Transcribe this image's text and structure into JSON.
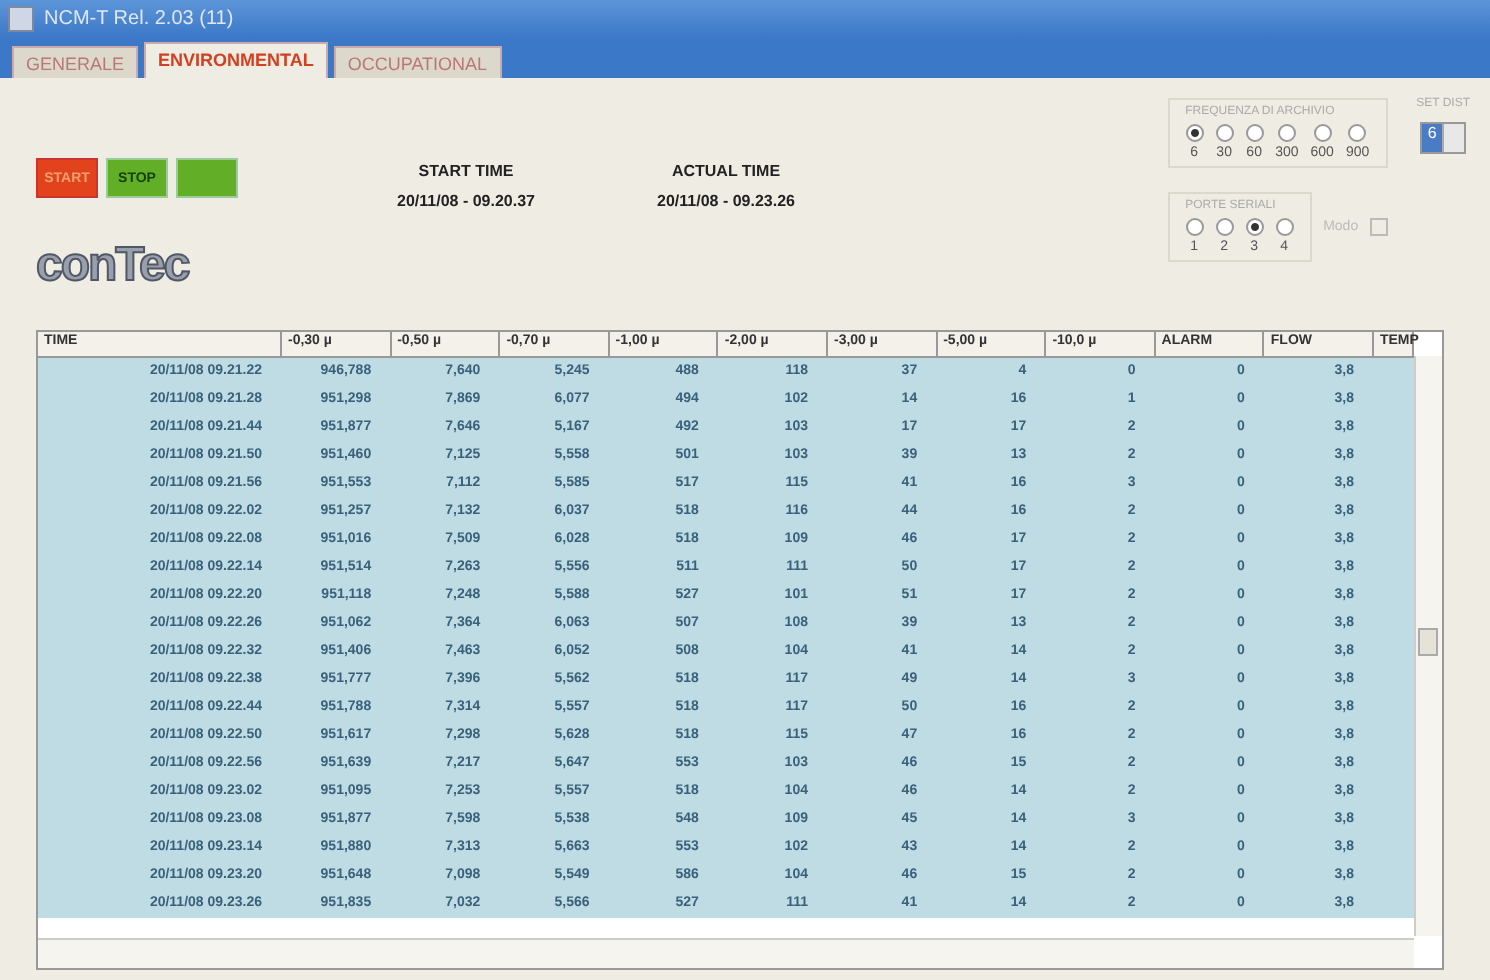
{
  "window": {
    "title": "NCM-T Rel. 2.03 (11)"
  },
  "tabs": [
    {
      "label": "GENERALE",
      "selected": false
    },
    {
      "label": "ENVIRONMENTAL",
      "selected": true
    },
    {
      "label": "OCCUPATIONAL",
      "selected": false
    }
  ],
  "buttons": [
    {
      "label": "START",
      "kind": "start"
    },
    {
      "label": "STOP",
      "kind": "stop"
    },
    {
      "kind": "plain"
    }
  ],
  "start_time": {
    "label": "START TIME",
    "value": "20/11/08 - 09.20.37"
  },
  "actual_time": {
    "label": "ACTUAL TIME",
    "value": "20/11/08 - 09.23.26"
  },
  "logo": {
    "text": "conTec"
  },
  "frequency": {
    "title": "FREQUENZA DI ARCHIVIO",
    "options": [
      {
        "label": "6",
        "selected": true
      },
      {
        "label": "30",
        "selected": false
      },
      {
        "label": "60",
        "selected": false
      },
      {
        "label": "300",
        "selected": false
      },
      {
        "label": "600",
        "selected": false
      },
      {
        "label": "900",
        "selected": false
      }
    ]
  },
  "serial_port": {
    "title": "PORTE SERIALI",
    "options": [
      {
        "label": "1",
        "selected": false
      },
      {
        "label": "2",
        "selected": false
      },
      {
        "label": "3",
        "selected": true
      },
      {
        "label": "4",
        "selected": false
      }
    ],
    "mode_label": "Modo",
    "mode_checked": false
  },
  "set_dist": {
    "label": "SET DIST",
    "value": "6"
  },
  "table": {
    "columns": [
      "TIME",
      "-0,30 µ",
      "-0,50 µ",
      "-0,70 µ",
      "-1,00 µ",
      "-2,00 µ",
      "-3,00 µ",
      "-5,00 µ",
      "-10,0 µ",
      "ALARM",
      "FLOW",
      "TEMP"
    ],
    "rows": [
      [
        "20/11/08 09.21.22",
        "946,788",
        "7,640",
        "5,245",
        "488",
        "118",
        "37",
        "4",
        "0",
        "0",
        "3,8"
      ],
      [
        "20/11/08 09.21.28",
        "951,298",
        "7,869",
        "6,077",
        "494",
        "102",
        "14",
        "16",
        "1",
        "0",
        "3,8"
      ],
      [
        "20/11/08 09.21.44",
        "951,877",
        "7,646",
        "5,167",
        "492",
        "103",
        "17",
        "17",
        "2",
        "0",
        "3,8"
      ],
      [
        "20/11/08 09.21.50",
        "951,460",
        "7,125",
        "5,558",
        "501",
        "103",
        "39",
        "13",
        "2",
        "0",
        "3,8"
      ],
      [
        "20/11/08 09.21.56",
        "951,553",
        "7,112",
        "5,585",
        "517",
        "115",
        "41",
        "16",
        "3",
        "0",
        "3,8"
      ],
      [
        "20/11/08 09.22.02",
        "951,257",
        "7,132",
        "6,037",
        "518",
        "116",
        "44",
        "16",
        "2",
        "0",
        "3,8"
      ],
      [
        "20/11/08 09.22.08",
        "951,016",
        "7,509",
        "6,028",
        "518",
        "109",
        "46",
        "17",
        "2",
        "0",
        "3,8"
      ],
      [
        "20/11/08 09.22.14",
        "951,514",
        "7,263",
        "5,556",
        "511",
        "111",
        "50",
        "17",
        "2",
        "0",
        "3,8"
      ],
      [
        "20/11/08 09.22.20",
        "951,118",
        "7,248",
        "5,588",
        "527",
        "101",
        "51",
        "17",
        "2",
        "0",
        "3,8"
      ],
      [
        "20/11/08 09.22.26",
        "951,062",
        "7,364",
        "6,063",
        "507",
        "108",
        "39",
        "13",
        "2",
        "0",
        "3,8"
      ],
      [
        "20/11/08 09.22.32",
        "951,406",
        "7,463",
        "6,052",
        "508",
        "104",
        "41",
        "14",
        "2",
        "0",
        "3,8"
      ],
      [
        "20/11/08 09.22.38",
        "951,777",
        "7,396",
        "5,562",
        "518",
        "117",
        "49",
        "14",
        "3",
        "0",
        "3,8"
      ],
      [
        "20/11/08 09.22.44",
        "951,788",
        "7,314",
        "5,557",
        "518",
        "117",
        "50",
        "16",
        "2",
        "0",
        "3,8"
      ],
      [
        "20/11/08 09.22.50",
        "951,617",
        "7,298",
        "5,628",
        "518",
        "115",
        "47",
        "16",
        "2",
        "0",
        "3,8"
      ],
      [
        "20/11/08 09.22.56",
        "951,639",
        "7,217",
        "5,647",
        "553",
        "103",
        "46",
        "15",
        "2",
        "0",
        "3,8"
      ],
      [
        "20/11/08 09.23.02",
        "951,095",
        "7,253",
        "5,557",
        "518",
        "104",
        "46",
        "14",
        "2",
        "0",
        "3,8"
      ],
      [
        "20/11/08 09.23.08",
        "951,877",
        "7,598",
        "5,538",
        "548",
        "109",
        "45",
        "14",
        "3",
        "0",
        "3,8"
      ],
      [
        "20/11/08 09.23.14",
        "951,880",
        "7,313",
        "5,663",
        "553",
        "102",
        "43",
        "14",
        "2",
        "0",
        "3,8"
      ],
      [
        "20/11/08 09.23.20",
        "951,648",
        "7,098",
        "5,549",
        "586",
        "104",
        "46",
        "15",
        "2",
        "0",
        "3,8"
      ],
      [
        "20/11/08 09.23.26",
        "951,835",
        "7,032",
        "5,566",
        "527",
        "111",
        "41",
        "14",
        "2",
        "0",
        "3,8"
      ]
    ]
  }
}
